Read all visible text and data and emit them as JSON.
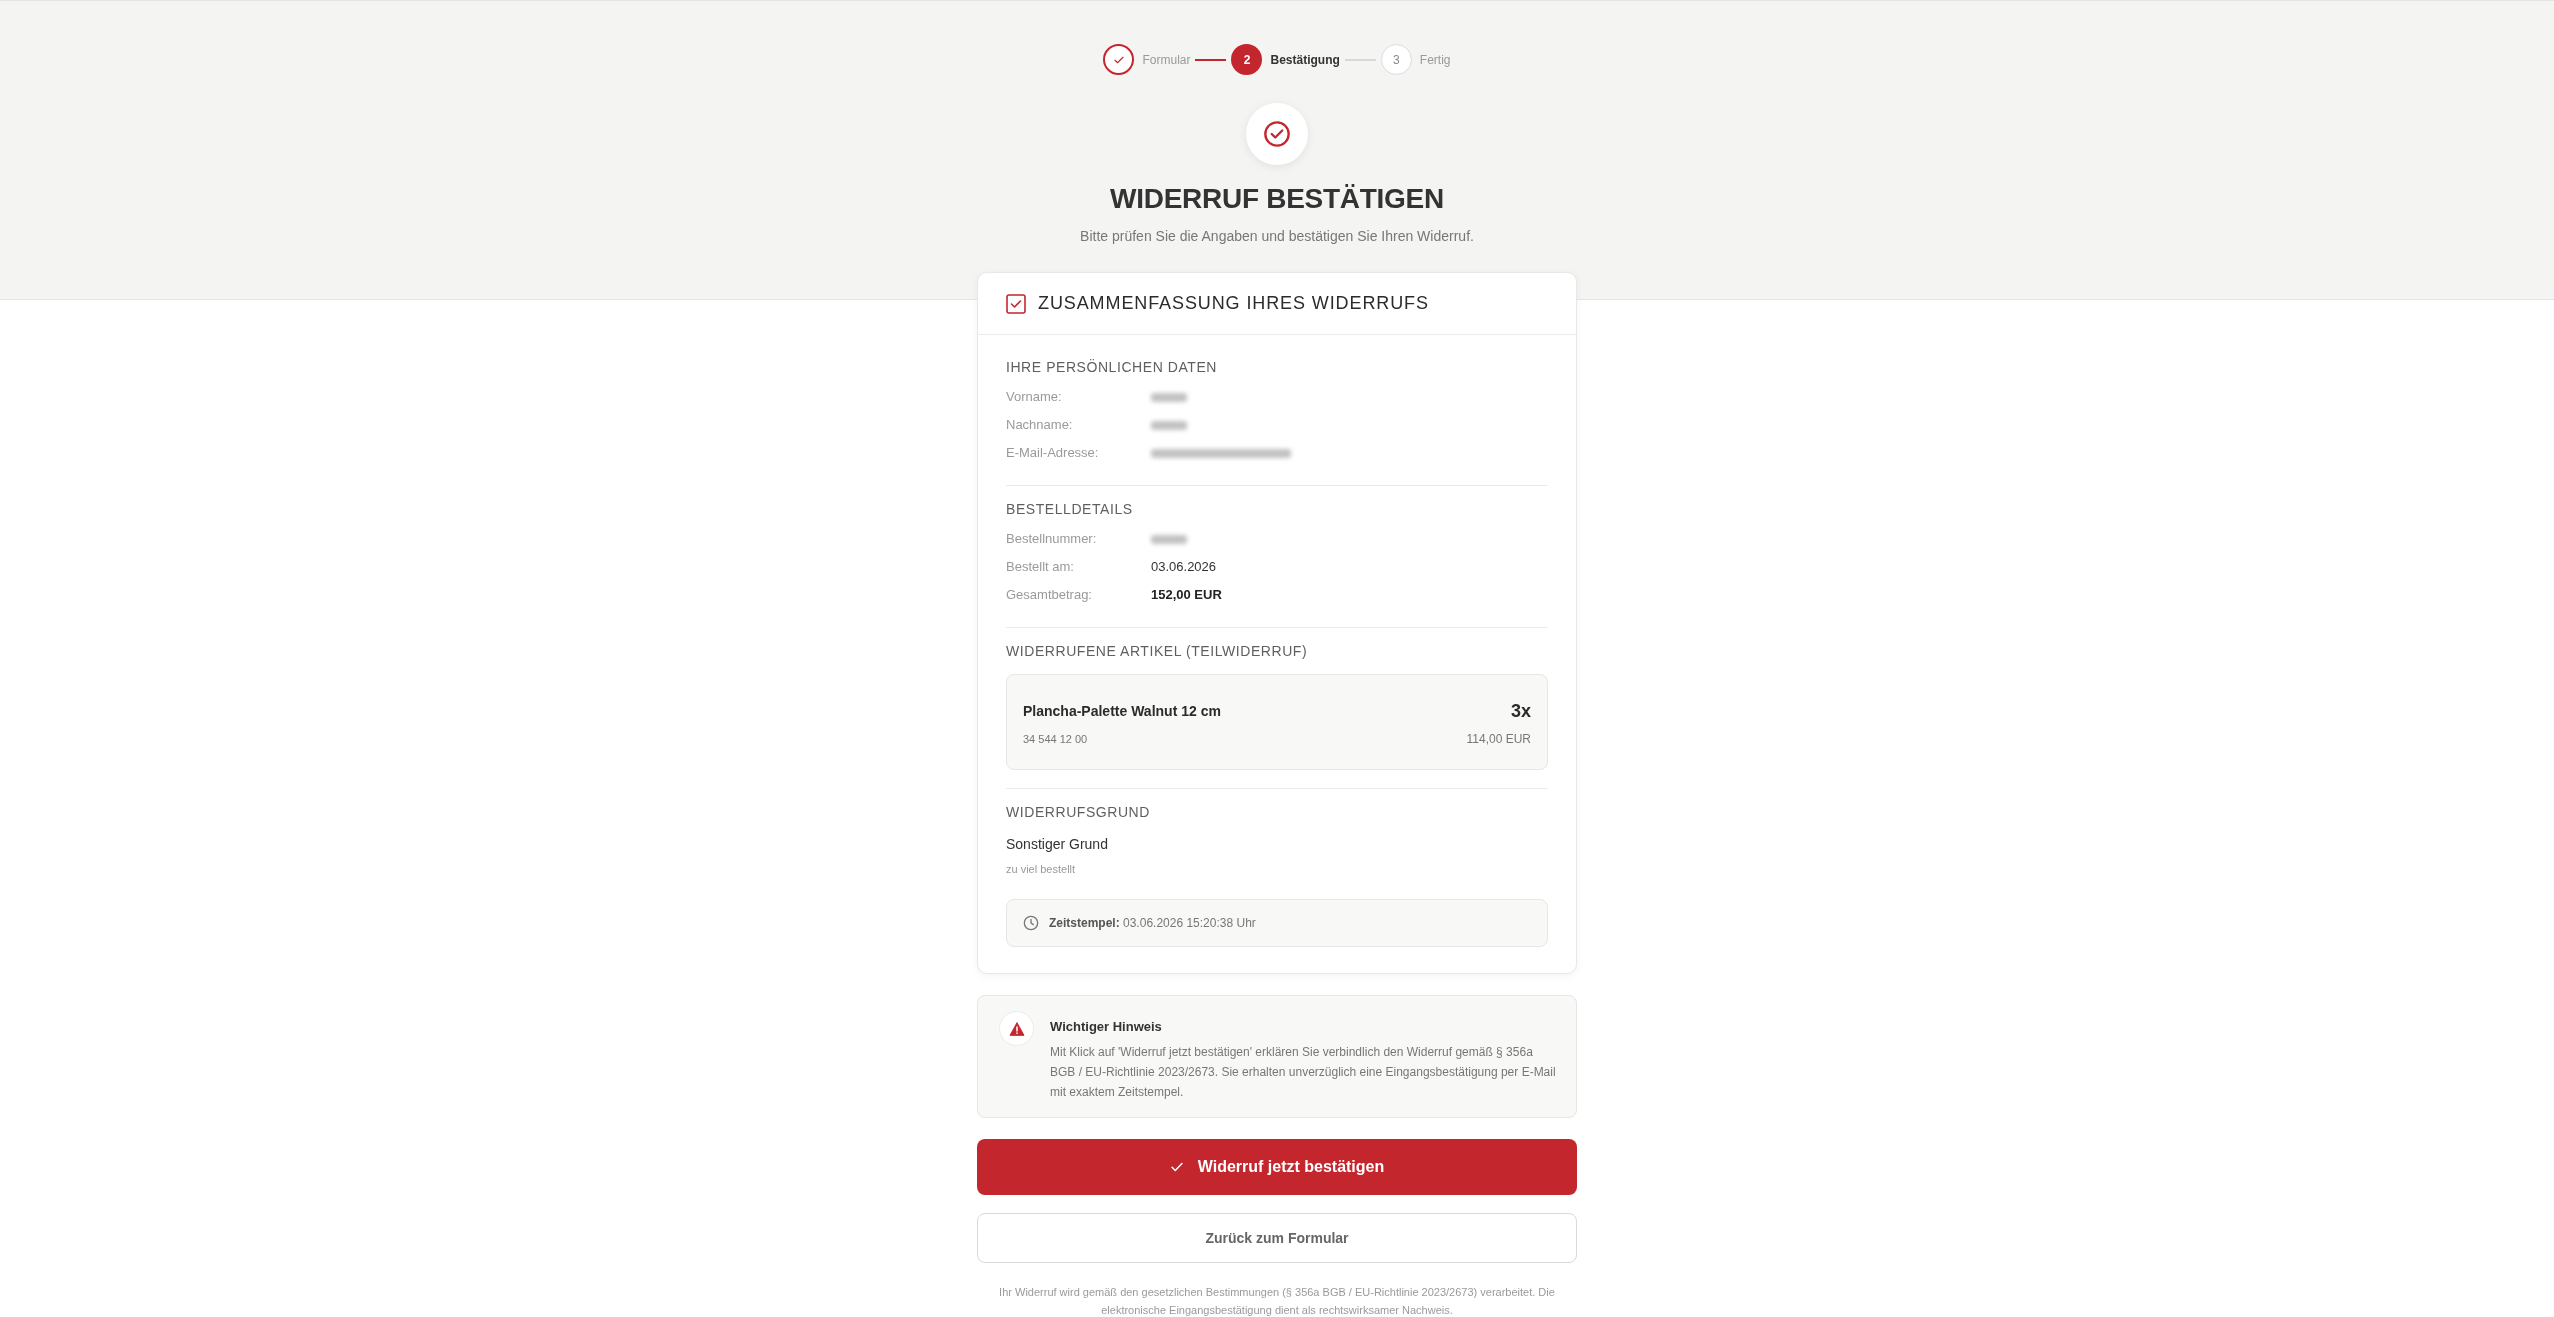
{
  "stepper": {
    "steps": [
      {
        "label": "Formular",
        "completed": true,
        "selected": false
      },
      {
        "number": "2",
        "label": "Bestätigung",
        "completed": false,
        "selected": true
      },
      {
        "number": "3",
        "label": "Fertig",
        "completed": false,
        "selected": false
      }
    ]
  },
  "header": {
    "title": "WIDERRUF BESTÄTIGEN",
    "subtitle": "Bitte prüfen Sie die Angaben und bestätigen Sie Ihren Widerruf."
  },
  "summary": {
    "title": "ZUSAMMENFASSUNG IHRES WIDERRUFS",
    "sections": [
      {
        "kind": "fields",
        "heading": "IHRE PERSÖNLICHEN DATEN",
        "fields": [
          {
            "label": "Vorname:",
            "kind": "blurred"
          },
          {
            "label": "Nachname:",
            "kind": "blurred"
          },
          {
            "label": "E-Mail-Adresse:",
            "kind": "blurred_wide"
          }
        ]
      },
      {
        "kind": "fields",
        "heading": "BESTELLDETAILS",
        "fields": [
          {
            "label": "Bestellnummer:",
            "kind": "blurred"
          },
          {
            "label": "Bestellt am:",
            "kind": "text",
            "value": "03.06.2026"
          },
          {
            "label": "Gesamtbetrag:",
            "kind": "strong",
            "value": "152,00 EUR"
          }
        ]
      },
      {
        "kind": "items",
        "heading": "WIDERRUFENE ARTIKEL (TEILWIDERRUF)",
        "items": [
          {
            "name": "Plancha-Palette Walnut 12 cm",
            "quantity": "3x",
            "sku": "34 544 12 00",
            "price": "114,00 EUR"
          }
        ]
      },
      {
        "kind": "reason",
        "heading": "WIDERRUFSGRUND",
        "reason": "Sonstiger Grund",
        "comment": "zu viel bestellt",
        "timestamp": "**Zeitstempel:** 03.06.2026 15:20:38 Uhr"
      }
    ]
  },
  "notice": {
    "title": "Wichtiger Hinweis",
    "text": "Mit Klick auf 'Widerruf jetzt bestätigen' erklären Sie verbindlich den Widerruf gemäß § 356a BGB / EU-Richtlinie 2023/2673. Sie erhalten unverzüglich eine Eingangsbestätigung per E-Mail mit exaktem Zeitstempel."
  },
  "actions": [
    {
      "kind": "primary",
      "label": "Widerruf jetzt bestätigen"
    },
    {
      "kind": "secondary",
      "label": "Zurück zum Formular"
    }
  ],
  "footer": "Ihr Widerruf wird gemäß den gesetzlichen Bestimmungen (§ 356a BGB / EU-Richtlinie 2023/2673) verarbeitet. Die elektronische Eingangsbestätigung dient als rechtswirksamer Nachweis."
}
